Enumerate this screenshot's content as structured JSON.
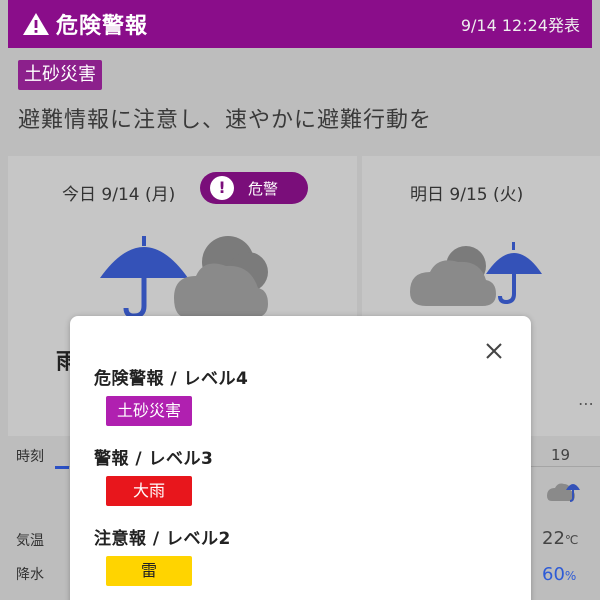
{
  "header": {
    "title": "危険警報",
    "time": "9/14 12:24発表",
    "color": "#8a0d8a"
  },
  "category_tag": "土砂災害",
  "advice": "避難情報に注意し、速やかに避難行動を",
  "cards": {
    "today": {
      "label": "今日 9/14 (月)",
      "pill_icon": "!",
      "pill_text": "危警",
      "weather": "雨",
      "icon": "umbrella-cloud-icon"
    },
    "tomorrow": {
      "label": "明日 9/15 (火)",
      "icon": "cloud-umbrella-icon"
    }
  },
  "hourly": {
    "time_label": "時刻",
    "temp_label": "気温",
    "rain_label": "降水",
    "hour": "19",
    "temp": "22",
    "temp_unit": "℃",
    "rain": "60",
    "rain_unit": "%"
  },
  "modal": {
    "levels": [
      {
        "heading": "危険警報 / レベル4",
        "tag": "土砂災害",
        "color": "#b020b0"
      },
      {
        "heading": "警報 / レベル3",
        "tag": "大雨",
        "color": "#e8161c"
      },
      {
        "heading": "注意報 / レベル2",
        "tag": "雷",
        "color": "#ffd400"
      }
    ]
  }
}
